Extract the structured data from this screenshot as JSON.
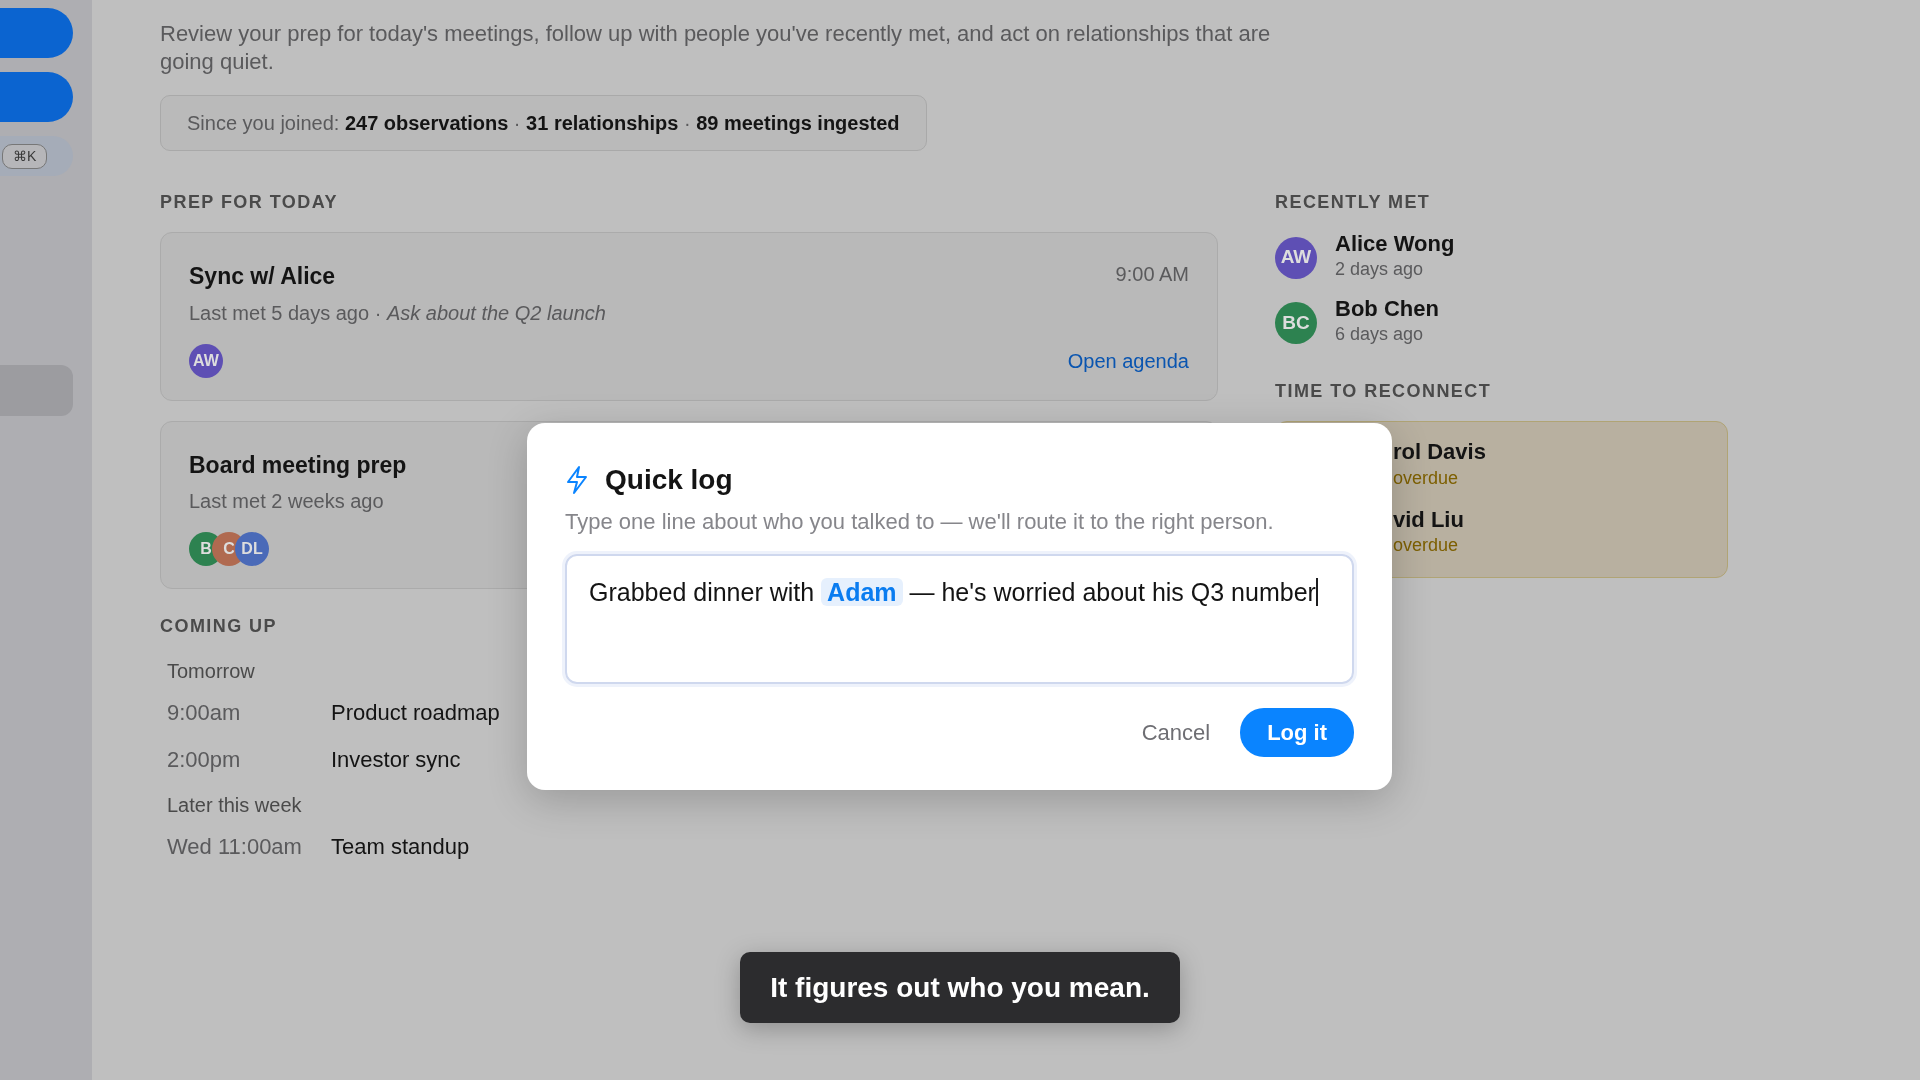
{
  "sidebar": {
    "shortcut": "⌘K",
    "items": [
      {
        "kind": "primary",
        "selected": false
      },
      {
        "kind": "primary",
        "selected": false
      },
      {
        "kind": "search",
        "selected": false
      },
      {
        "kind": "plain",
        "selected": true
      }
    ]
  },
  "intro": "Review your prep for today's meetings, follow up with people you've recently met, and act on relationships that are going quiet.",
  "stats": "Since you joined: **247 observations** · **31 relationships** · **89 meetings ingested**",
  "prep": {
    "heading": "PREP FOR TODAY",
    "meetings": [
      {
        "title": "Sync w/ Alice",
        "time": "9:00 AM",
        "subtitle": "Last met 5 days ago · *Ask about the Q2 launch*",
        "attendees": [
          {
            "initials": "AW",
            "color": "#5e4fb4"
          }
        ],
        "action": "Open agenda"
      },
      {
        "title": "Board meeting prep",
        "subtitle": "Last met 2 weeks ago",
        "attendees": [
          {
            "initials": "B",
            "color": "#2d8250"
          },
          {
            "initials": "C",
            "color": "#b06a50"
          },
          {
            "initials": "DL",
            "color": "#4a6ab8"
          }
        ]
      }
    ]
  },
  "coming_up": {
    "heading": "COMING UP",
    "groups": [
      {
        "label": "Tomorrow",
        "events": [
          {
            "time": "9:00am",
            "title": "Product roadmap"
          },
          {
            "time": "2:00pm",
            "title": "Investor sync"
          }
        ]
      },
      {
        "label": "Later this week",
        "events": [
          {
            "time": "Wed 11:00am",
            "title": "Team standup"
          }
        ]
      }
    ]
  },
  "recently_met": {
    "heading": "RECENTLY MET",
    "people": [
      {
        "initials": "AW",
        "color": "#5e4fb4",
        "name": "Alice Wong",
        "when": "2 days ago"
      },
      {
        "initials": "BC",
        "color": "#2d8250",
        "name": "Bob Chen",
        "when": "6 days ago"
      }
    ]
  },
  "reconnect": {
    "heading": "TIME TO RECONNECT",
    "people": [
      {
        "name": "rol Davis",
        "status": "overdue"
      },
      {
        "name": "vid Liu",
        "status": "overdue"
      }
    ]
  },
  "dialog": {
    "title": "Quick log",
    "subtitle": "Type one line about who you talked to — we'll route it to the right person.",
    "focused": true,
    "input": [
      {
        "kind": "text",
        "text": "Grabbed dinner with "
      },
      {
        "kind": "mention",
        "text": "Adam"
      },
      {
        "kind": "text",
        "text": " — he's worried about his Q3 number"
      }
    ],
    "cancel": "Cancel",
    "submit": "Log it"
  },
  "toast": "It figures out who you mean."
}
